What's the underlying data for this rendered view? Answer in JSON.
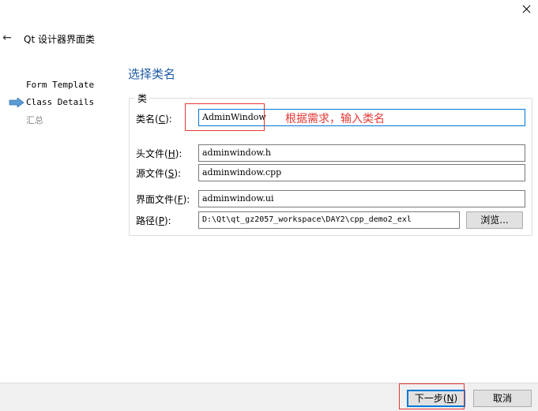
{
  "window": {
    "close_icon": "close-icon",
    "back_icon": "back-arrow-icon",
    "title": "Qt 设计器界面类"
  },
  "steps": [
    {
      "label": "Form Template",
      "state": "done"
    },
    {
      "label": "Class Details",
      "state": "current"
    },
    {
      "label": "汇总",
      "state": "pending"
    }
  ],
  "page": {
    "heading": "选择类名",
    "group_title": "类"
  },
  "fields": {
    "classname": {
      "label": "类名",
      "mnemonic": "C",
      "value": "AdminWindow"
    },
    "header": {
      "label": "头文件",
      "mnemonic": "H",
      "value": "adminwindow.h"
    },
    "source": {
      "label": "源文件",
      "mnemonic": "S",
      "value": "adminwindow.cpp"
    },
    "form": {
      "label": "界面文件",
      "mnemonic": "F",
      "value": "adminwindow.ui"
    },
    "path": {
      "label": "路径",
      "mnemonic": "P",
      "value": "D:\\Qt\\qt_gz2057_workspace\\DAY2\\cpp_demo2_exl"
    }
  },
  "browse_label": "浏览...",
  "annotation": "根据需求，输入类名",
  "footer": {
    "next_label": "下一步",
    "next_mnemonic": "N",
    "cancel_label": "取消"
  },
  "colors": {
    "heading": "#1c5aa6",
    "annotation": "#e53935",
    "focus": "#0078d7"
  }
}
